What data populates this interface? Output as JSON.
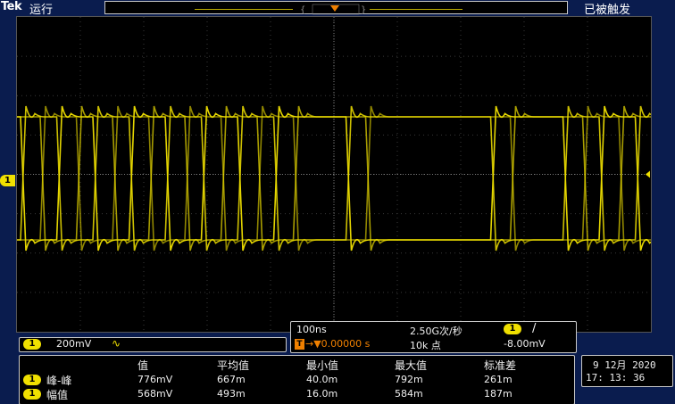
{
  "header": {
    "brand": "Tek",
    "run_state": "运行",
    "trigger_state": "已被触发",
    "trigger_marker": "T"
  },
  "channel": {
    "id": "1",
    "scale": "200mV",
    "coupling_icon": "∿",
    "color": "#f0e000"
  },
  "horizontal": {
    "time_per_div": "100ns",
    "sample_rate": "2.50G次/秒",
    "trigger_source": "1",
    "trigger_slope_icon": "/",
    "trigger_position": "→▼0.00000 s",
    "record_length": "10k 点",
    "trigger_level": "-8.00mV"
  },
  "measurements": {
    "headers": [
      "值",
      "平均值",
      "最小值",
      "最大值",
      "标准差"
    ],
    "rows": [
      {
        "ch": "1",
        "name": "峰-峰",
        "value": "776mV",
        "mean": "667m",
        "min": "40.0m",
        "max": "792m",
        "std": "261m"
      },
      {
        "ch": "1",
        "name": "幅值",
        "value": "568mV",
        "mean": "493m",
        "min": "16.0m",
        "max": "584m",
        "std": "187m"
      }
    ]
  },
  "datetime": {
    "date": "9 12月  2020",
    "time": "17: 13: 36"
  }
}
